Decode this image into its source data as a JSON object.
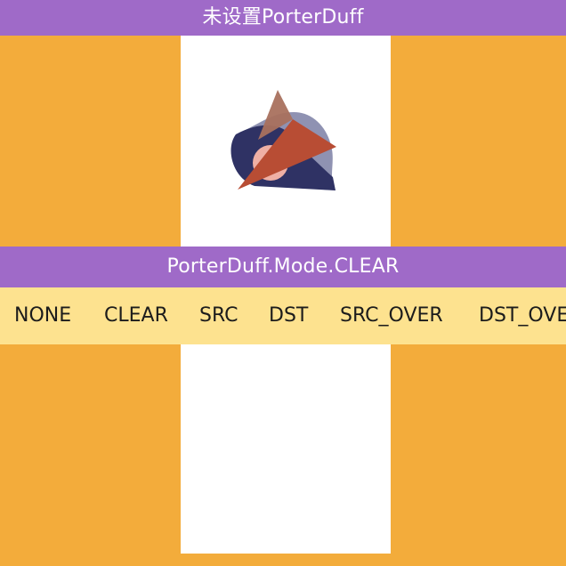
{
  "top_bar": {
    "title": "未设置PorterDuff"
  },
  "mode_bar": {
    "title": "PorterDuff.Mode.CLEAR"
  },
  "modes": [
    "NONE",
    "CLEAR",
    "SRC",
    "DST",
    "SRC_OVER",
    "DST_OVER"
  ],
  "colors": {
    "background": "#f3ac3b",
    "header": "#9f6ac8",
    "mode_strip": "#fde28f",
    "canvas": "#ffffff",
    "dst_shape": "#2f3264",
    "dst_shape_light": "#8f92b2",
    "src_shape": "#b84d34",
    "circle": "#efb0a5"
  }
}
